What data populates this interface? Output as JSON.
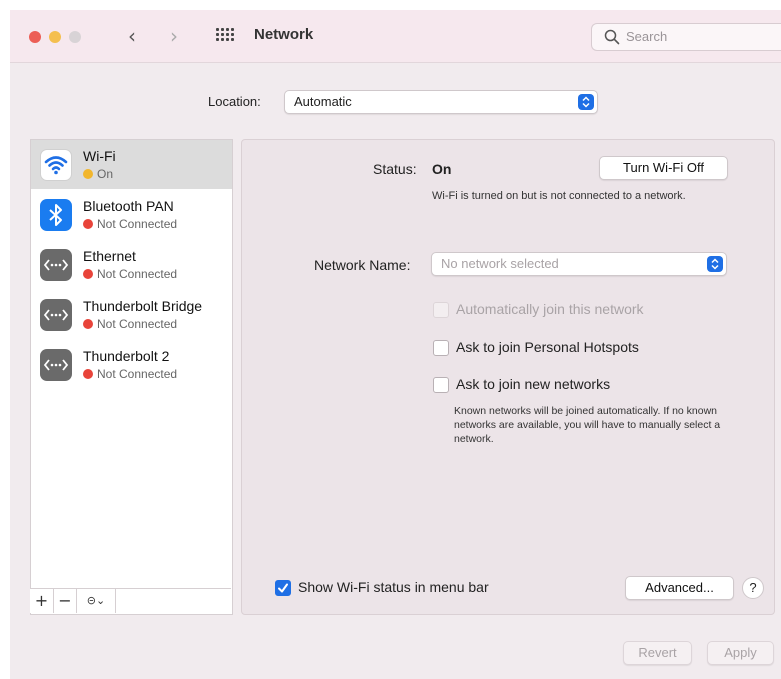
{
  "window": {
    "title": "Network",
    "search_placeholder": "Search"
  },
  "location": {
    "label": "Location:",
    "value": "Automatic"
  },
  "services": [
    {
      "name": "Wi-Fi",
      "status": "On",
      "status_color": "#f2b62c",
      "icon": "wifi-icon"
    },
    {
      "name": "Bluetooth PAN",
      "status": "Not Connected",
      "status_color": "#e8443a",
      "icon": "bluetooth-icon"
    },
    {
      "name": "Ethernet",
      "status": "Not Connected",
      "status_color": "#e8443a",
      "icon": "ethernet-icon"
    },
    {
      "name": "Thunderbolt Bridge",
      "status": "Not Connected",
      "status_color": "#e8443a",
      "icon": "ethernet-icon"
    },
    {
      "name": "Thunderbolt 2",
      "status": "Not Connected",
      "status_color": "#e8443a",
      "icon": "ethernet-icon"
    }
  ],
  "sidebar_tools": {
    "add": "+",
    "remove": "−",
    "action": "⊝⌄"
  },
  "detail": {
    "status_label": "Status:",
    "status_value": "On",
    "turn_off_button": "Turn Wi-Fi Off",
    "status_desc": "Wi-Fi is turned on but is not connected to a network.",
    "network_name_label": "Network Name:",
    "network_name_placeholder": "No network selected",
    "auto_join_label": "Automatically join this network",
    "ask_hotspots_label": "Ask to join Personal Hotspots",
    "ask_new_label": "Ask to join new networks",
    "ask_new_desc": "Known networks will be joined automatically. If no known networks are available, you will have to manually select a network.",
    "show_status_label": "Show Wi-Fi status in menu bar",
    "advanced_button": "Advanced...",
    "help_button": "?"
  },
  "footer": {
    "revert_button": "Revert",
    "apply_button": "Apply"
  },
  "colors": {
    "accent": "#1f6fe5",
    "close": "#ec5e56",
    "minimize": "#f4bf4f"
  }
}
